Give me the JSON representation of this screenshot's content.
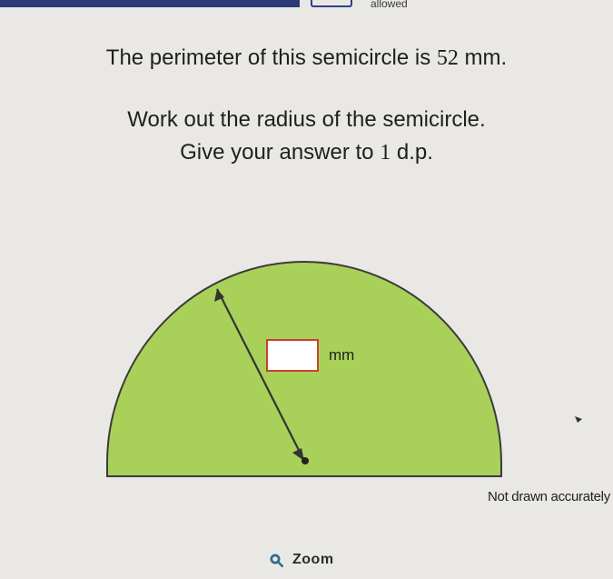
{
  "header": {
    "allowed_text": "allowed"
  },
  "question": {
    "line1_pre": "The perimeter of this semicircle is ",
    "line1_value": "52",
    "line1_unit": " mm.",
    "line2": "Work out the radius of the semicircle.",
    "line3_pre": "Give your answer to ",
    "line3_dp": "1",
    "line3_post": " d.p."
  },
  "diagram": {
    "fill_color": "#a9d15a",
    "unit_label": "mm",
    "note": "Not drawn accurately"
  },
  "zoom": {
    "label": "Zoom",
    "icon": "magnifier-icon"
  },
  "colors": {
    "answer_box_border": "#c8412f",
    "top_bar": "#2b3a78"
  }
}
